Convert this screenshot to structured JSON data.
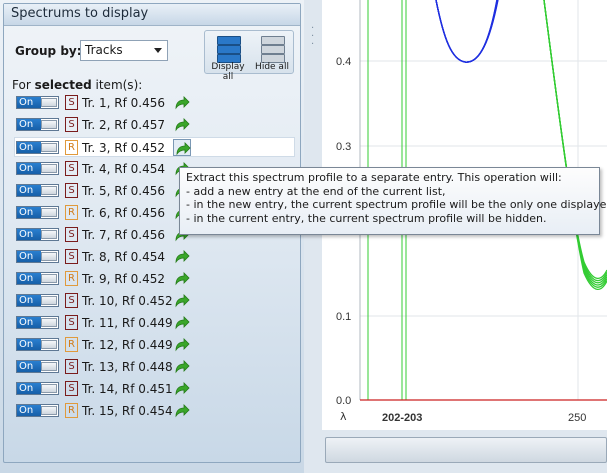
{
  "panel": {
    "title": "Spectrums to display",
    "group_by_label": "Group by:",
    "group_by_value": "Tracks",
    "display_all_label": "Display all",
    "hide_all_label": "Hide all",
    "for_selected_prefix": "For ",
    "for_selected_bold": "selected",
    "for_selected_suffix": " item(s):",
    "toggle_label": "On",
    "items": [
      {
        "badge": "S",
        "label": "Tr. 1, Rf 0.456"
      },
      {
        "badge": "S",
        "label": "Tr. 2, Rf 0.457"
      },
      {
        "badge": "R",
        "label": "Tr. 3, Rf 0.452"
      },
      {
        "badge": "S",
        "label": "Tr. 4, Rf 0.454"
      },
      {
        "badge": "S",
        "label": "Tr. 5, Rf 0.456"
      },
      {
        "badge": "R",
        "label": "Tr. 6, Rf 0.456"
      },
      {
        "badge": "S",
        "label": "Tr. 7, Rf 0.456"
      },
      {
        "badge": "S",
        "label": "Tr. 8, Rf 0.454"
      },
      {
        "badge": "R",
        "label": "Tr. 9, Rf 0.452"
      },
      {
        "badge": "S",
        "label": "Tr. 10, Rf 0.452"
      },
      {
        "badge": "S",
        "label": "Tr. 11, Rf 0.449"
      },
      {
        "badge": "R",
        "label": "Tr. 12, Rf 0.449"
      },
      {
        "badge": "S",
        "label": "Tr. 13, Rf 0.448"
      },
      {
        "badge": "S",
        "label": "Tr. 14, Rf 0.451"
      },
      {
        "badge": "R",
        "label": "Tr. 15, Rf 0.454"
      }
    ],
    "highlighted_index": 2
  },
  "tooltip": {
    "lines": [
      "Extract this spectrum profile to a separate entry. This operation will:",
      "- add a new entry at the end of the current list,",
      "- in the new entry, the current spectrum profile will be the only one displayed,",
      "- in the current entry, the current spectrum profile will be hidden."
    ]
  },
  "chart": {
    "y_ticks": [
      "0.4",
      "0.3",
      "0.1",
      "0.0"
    ],
    "x_axis_symbol": "λ",
    "x_ticks": [
      "202-203",
      "250"
    ],
    "colors": {
      "blue": "#1f2fe0",
      "green": "#33cc33",
      "axis": "#cc2222"
    }
  },
  "colors": {
    "toggle_on": "#1f6fc0",
    "badge_S": "#7a1c1c",
    "badge_R": "#d07a16",
    "arrow": "#3aa62a"
  }
}
